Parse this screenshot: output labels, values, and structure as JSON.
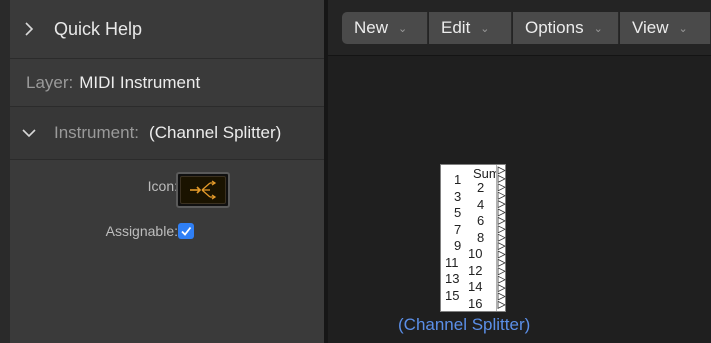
{
  "inspector": {
    "quick_help": "Quick Help",
    "layer_key": "Layer:",
    "layer_value": "MIDI Instrument",
    "instrument_key": "Instrument:",
    "instrument_value": "(Channel Splitter)",
    "icon_label": "Icon:",
    "assignable_label": "Assignable:",
    "assignable_checked": true,
    "accent": "#2f7ff5"
  },
  "menubar": {
    "new": "New",
    "edit": "Edit",
    "options": "Options",
    "view": "View"
  },
  "splitter": {
    "sum_label": "Sum",
    "left_numbers": [
      "1",
      "3",
      "5",
      "7",
      "9",
      "11",
      "13",
      "15"
    ],
    "right_numbers": [
      "2",
      "4",
      "6",
      "8",
      "10",
      "12",
      "14",
      "16"
    ],
    "name": "(Channel Splitter)",
    "name_color": "#5b8fe8"
  }
}
